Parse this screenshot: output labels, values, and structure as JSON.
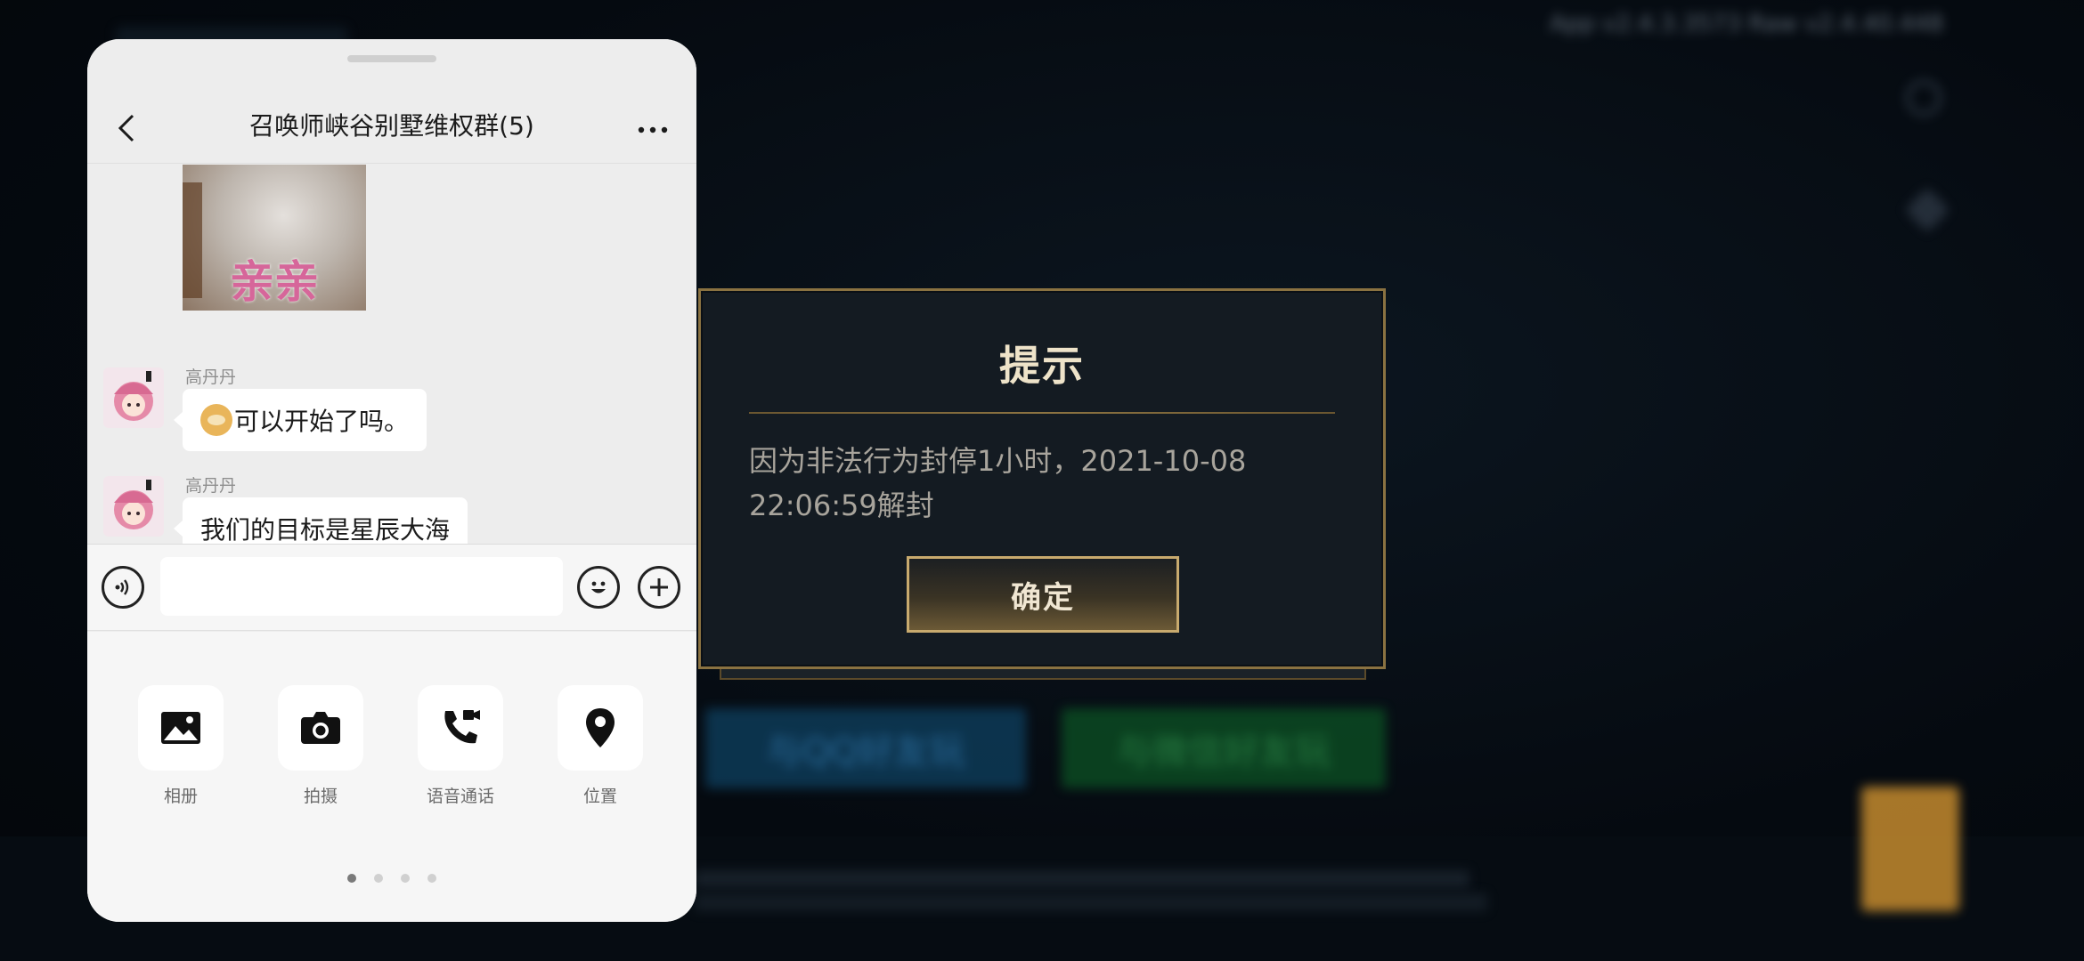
{
  "background": {
    "version_text": "App v2.4.3.3573 Raw v2.4.40.448",
    "qq_button_label": "与QQ好友玩",
    "wechat_button_label": "与微信好友玩"
  },
  "dialog": {
    "title": "提示",
    "message": "因为非法行为封停1小时，2021-10-08 22:06:59解封",
    "confirm_label": "确定",
    "accent_color": "#c8aa6e"
  },
  "chat": {
    "title": "召唤师峡谷别墅维权群(5)",
    "sticker_text": "亲亲",
    "messages": [
      {
        "sender": "高丹丹",
        "text": "可以开始了吗。",
        "emoji": "doge-emoji"
      },
      {
        "sender": "高丹丹",
        "text": "我们的目标是星辰大海"
      }
    ],
    "input": {
      "value": "",
      "placeholder": ""
    },
    "tools": [
      {
        "label": "相册",
        "icon": "image-icon"
      },
      {
        "label": "拍摄",
        "icon": "camera-icon"
      },
      {
        "label": "语音通话",
        "icon": "voice-call-icon"
      },
      {
        "label": "位置",
        "icon": "location-pin-icon"
      }
    ],
    "pager": {
      "pages": 4,
      "active": 1
    }
  }
}
